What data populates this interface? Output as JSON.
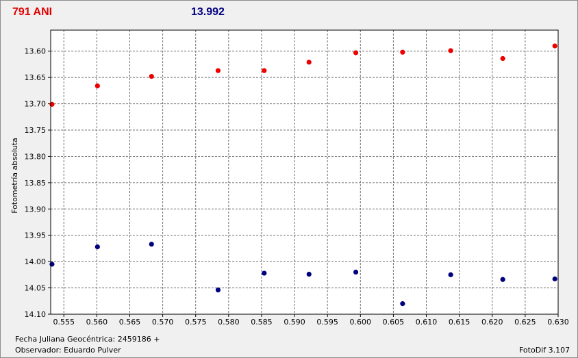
{
  "header": {
    "star_name": "791 ANI",
    "comparison_value": "13.992"
  },
  "footer": {
    "jd_label": "Fecha Juliana Geocéntrica: 2459186 +",
    "observer_label": "Observador: Eduardo Pulver",
    "software": "FotoDif 3.107"
  },
  "colors": {
    "series_variable": "#ee0000",
    "series_comparison": "#000080",
    "grid": "#707070",
    "plot_bg": "#ffffff"
  },
  "chart_data": {
    "type": "scatter",
    "title": "",
    "xlabel": "",
    "ylabel": "Fotometría absoluta",
    "xlim": [
      0.553,
      0.63
    ],
    "ylim": [
      14.1,
      13.56
    ],
    "y_inverted": true,
    "grid": true,
    "xticks": [
      "0.555",
      "0.560",
      "0.565",
      "0.570",
      "0.575",
      "0.580",
      "0.585",
      "0.590",
      "0.595",
      "0.600",
      "0.605",
      "0.610",
      "0.615",
      "0.620",
      "0.625",
      "0.630"
    ],
    "xtick_values": [
      0.555,
      0.56,
      0.565,
      0.57,
      0.575,
      0.58,
      0.585,
      0.59,
      0.595,
      0.6,
      0.605,
      0.61,
      0.615,
      0.62,
      0.625,
      0.63
    ],
    "yticks": [
      "13.60",
      "13.65",
      "13.70",
      "13.75",
      "13.80",
      "13.85",
      "13.90",
      "13.95",
      "14.00",
      "14.05",
      "14.10"
    ],
    "ytick_values": [
      13.6,
      13.65,
      13.7,
      13.75,
      13.8,
      13.85,
      13.9,
      13.95,
      14.0,
      14.05,
      14.1
    ],
    "series": [
      {
        "x": [
          0.5532,
          0.5601,
          0.5683,
          0.5784,
          0.5854,
          0.5922,
          0.5993,
          0.6064,
          0.6137,
          0.6216,
          0.6295
        ],
        "y": [
          13.701,
          13.666,
          13.648,
          13.637,
          13.637,
          13.621,
          13.603,
          13.602,
          13.599,
          13.614,
          13.59
        ],
        "color": "#ee0000"
      },
      {
        "x": [
          0.5532,
          0.5601,
          0.5683,
          0.5784,
          0.5854,
          0.5922,
          0.5993,
          0.6064,
          0.6137,
          0.6216,
          0.6295
        ],
        "y": [
          14.005,
          13.972,
          13.967,
          14.054,
          14.022,
          14.024,
          14.02,
          14.08,
          14.025,
          14.034,
          14.033
        ],
        "color": "#000080"
      }
    ]
  }
}
